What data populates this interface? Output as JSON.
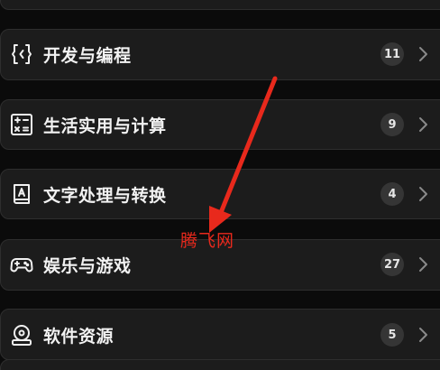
{
  "categories": [
    {
      "label": "开发与编程",
      "count": "11",
      "icon": "code-brackets-icon"
    },
    {
      "label": "生活实用与计算",
      "count": "9",
      "icon": "calculator-icon"
    },
    {
      "label": "文字处理与转换",
      "count": "4",
      "icon": "text-book-icon"
    },
    {
      "label": "娱乐与游戏",
      "count": "27",
      "icon": "gamepad-icon"
    },
    {
      "label": "软件资源",
      "count": "5",
      "icon": "software-disk-icon"
    }
  ],
  "watermark": "腾飞网",
  "colors": {
    "background": "#0b0b0b",
    "card": "#1c1c1c",
    "badge": "#353535",
    "annotation_red": "#e8291c"
  }
}
